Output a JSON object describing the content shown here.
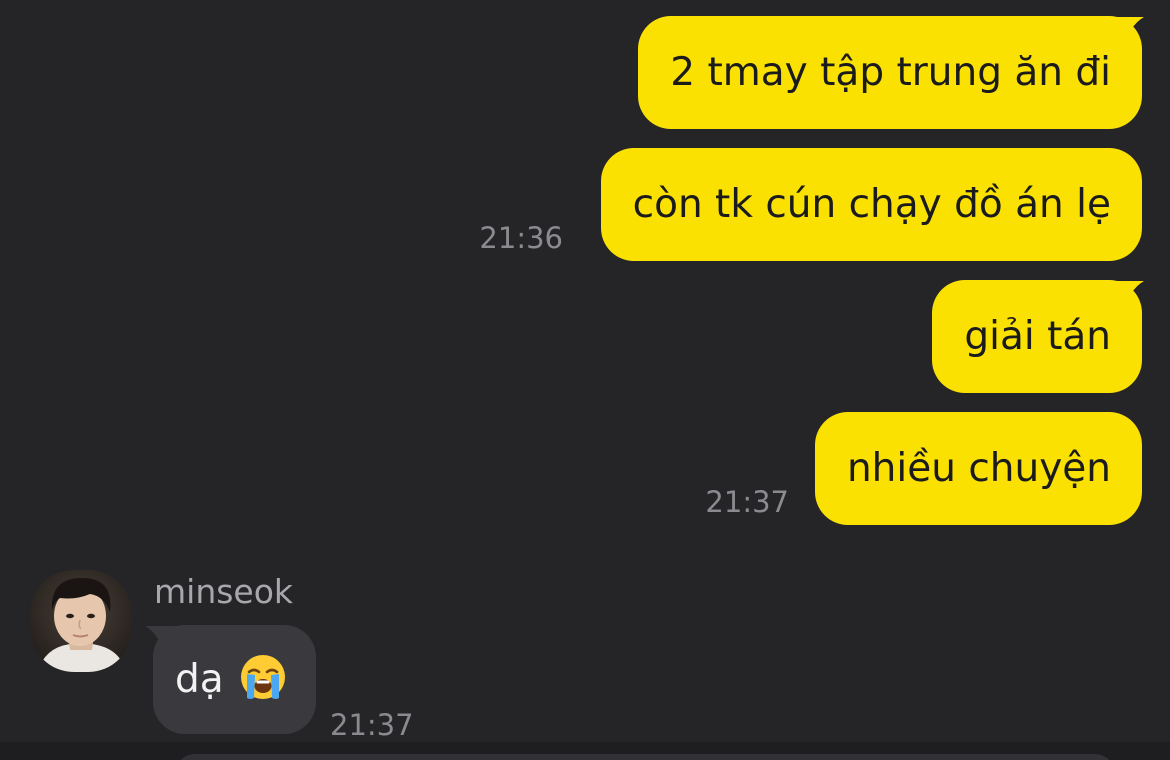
{
  "conversation": {
    "outgoing": [
      {
        "text": "2 tmay tập trung ăn đi"
      },
      {
        "text": "còn tk cún chạy đồ án lẹ",
        "time": "21:36"
      },
      {
        "text": "giải tán"
      },
      {
        "text": "nhiều chuyện",
        "time": "21:37"
      }
    ],
    "incoming": {
      "sender": "minseok",
      "avatar_icon": "avatar-photo",
      "text": "dạ",
      "emoji_icon": "loudly-crying-face-icon",
      "time": "21:37"
    }
  },
  "colors": {
    "background": "#252528",
    "outgoing_bubble": "#fae102",
    "incoming_bubble": "#3a3a3e",
    "timestamp": "#8a8a8f"
  }
}
